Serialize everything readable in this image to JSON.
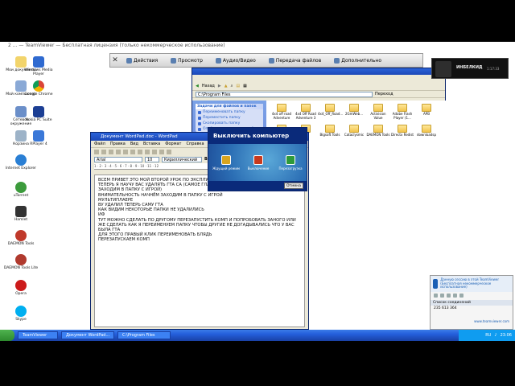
{
  "video_title": "2 ... — TeamViewer — Бесплатная лицензия (только некоммерческое использование)",
  "desktop_icons": [
    {
      "label": "Мои документы"
    },
    {
      "label": "Windows Media Player"
    },
    {
      "label": "Мой компьютер"
    },
    {
      "label": "Google Chrome"
    },
    {
      "label": "Сетевое окружение"
    },
    {
      "label": "Nokia PC Suite"
    },
    {
      "label": "Корзина"
    },
    {
      "label": "RPlayer 4"
    },
    {
      "label": "Internet Explorer"
    },
    {
      "label": "uTorrent"
    },
    {
      "label": "Hamlet"
    },
    {
      "label": "DAEMON Tools"
    },
    {
      "label": "DAEMON Tools Lite"
    },
    {
      "label": "Opera"
    },
    {
      "label": "Skype"
    }
  ],
  "toolbar": {
    "close": "✕",
    "actions": "Действия",
    "view": "Просмотр",
    "audio_video": "Аудио/Видео",
    "file_transfer": "Передача файлов",
    "extra": "Дополнительно"
  },
  "explorer": {
    "back": "Назад",
    "address": "C:\\Program Files",
    "go": "Переход",
    "task_header": "Задачи для файлов и папок",
    "tasks": [
      "Переименовать папку",
      "Переместить папку",
      "Скопировать папку",
      "Опубликовать папку в вебе"
    ],
    "folders": [
      {
        "label": "4x4 off road Adventure"
      },
      {
        "label": "4x4 Off Road Adventure 3"
      },
      {
        "label": "4x4_Off_Road..."
      },
      {
        "label": "2GmWeb..."
      },
      {
        "label": "Activision Value"
      },
      {
        "label": "Adobe Flash Player (1..."
      },
      {
        "label": "APB"
      },
      {
        "label": ""
      },
      {
        "label": ""
      },
      {
        "label": "Bigsoft Tools"
      },
      {
        "label": "Cataclysmic"
      },
      {
        "label": "DAEMON Tools"
      },
      {
        "label": "Directx Redist"
      },
      {
        "label": "downloadsp"
      }
    ]
  },
  "wordpad": {
    "title": "Документ WordPad.doc - WordPad",
    "menu": [
      "Файл",
      "Правка",
      "Вид",
      "Вставка",
      "Формат",
      "Справка"
    ],
    "font": "Arial",
    "size": "10",
    "script": "Кириллический",
    "ruler": "1 · 2 · 3 · 4 · 5 · 6 · 7 · 8 · 9 · 10 · 11 · 12",
    "content": "ВСЕМ ПРИВЕТ ЭТО МОЙ ВТОРОЙ УРОК ПО ЭКСПЛУАТАЦИИ\nТЕПЕРЬ Я НАУЧУ ВАС УДАЛЯТЬ ГТА СА (САМОЕ ГЛАВНОЕ ВНИМАТЕЛЬНОСТЬ НАЧНЁМ ЗАХОДИМ В ПАПКУ С ИГРОЙ)\nВНИМАТЕЛЬНОСТЬ НАЧНЁМ ЗАХОДИМ В ПАПКУ С ИГРОЙ\nМУЛЬТИПЛАЕРЕ\nВУ УДАЛИЛ ТЕПЕРЬ САМУ ГТА\nКАК ВИДИМ НЕКОТОРЫЕ ПАПКИ НЕ УДАЛИЛИСЬ\nИФ\nТУТ МОЖНО СДЕЛАТЬ ПО ДРУГОМУ ПЕРЕЗАПУСТИТЬ КОМП И ПОПРОБОВАТЬ ЗАНОГО ИЛИ ЖЕ СДЕЛАТЬ КАК Я ПЕРЕИМЕНУЕМ ПАПКУ ЧТОБЫ ДРУГИЕ НЕ ДОГАДЫВАЛИСЬ ЧТО У ВАС БЫЛА ГТА\nДЛЯ ЭТОГО ПРАВЫЙ КЛИК ПЕРЕИМЕНОВАТЬ БЛЯДЬ\nПЕРЕЗАПУСКАЕМ КОМП"
  },
  "shutdown": {
    "title": "Выключить компьютер",
    "standby": "Ждущий режим",
    "turn_off": "Выключение",
    "restart": "Перезагрузка",
    "cancel": "Отмена"
  },
  "tv_overlay": {
    "name": "ИНБЕЛКИД",
    "time": "1:17:33"
  },
  "tv_panel": {
    "notice": "Данную сессию в этой TeamViewer (Бесплатная некоммерческое использование)",
    "session_header": "Список соединений",
    "session_id": "235 613 364",
    "link": "www.teamviewer.com"
  },
  "taskbar": {
    "items": [
      "TeamViewer",
      "Документ WordPad...",
      "C:\\Program Files"
    ],
    "lang": "RU",
    "clock": "23:06"
  }
}
